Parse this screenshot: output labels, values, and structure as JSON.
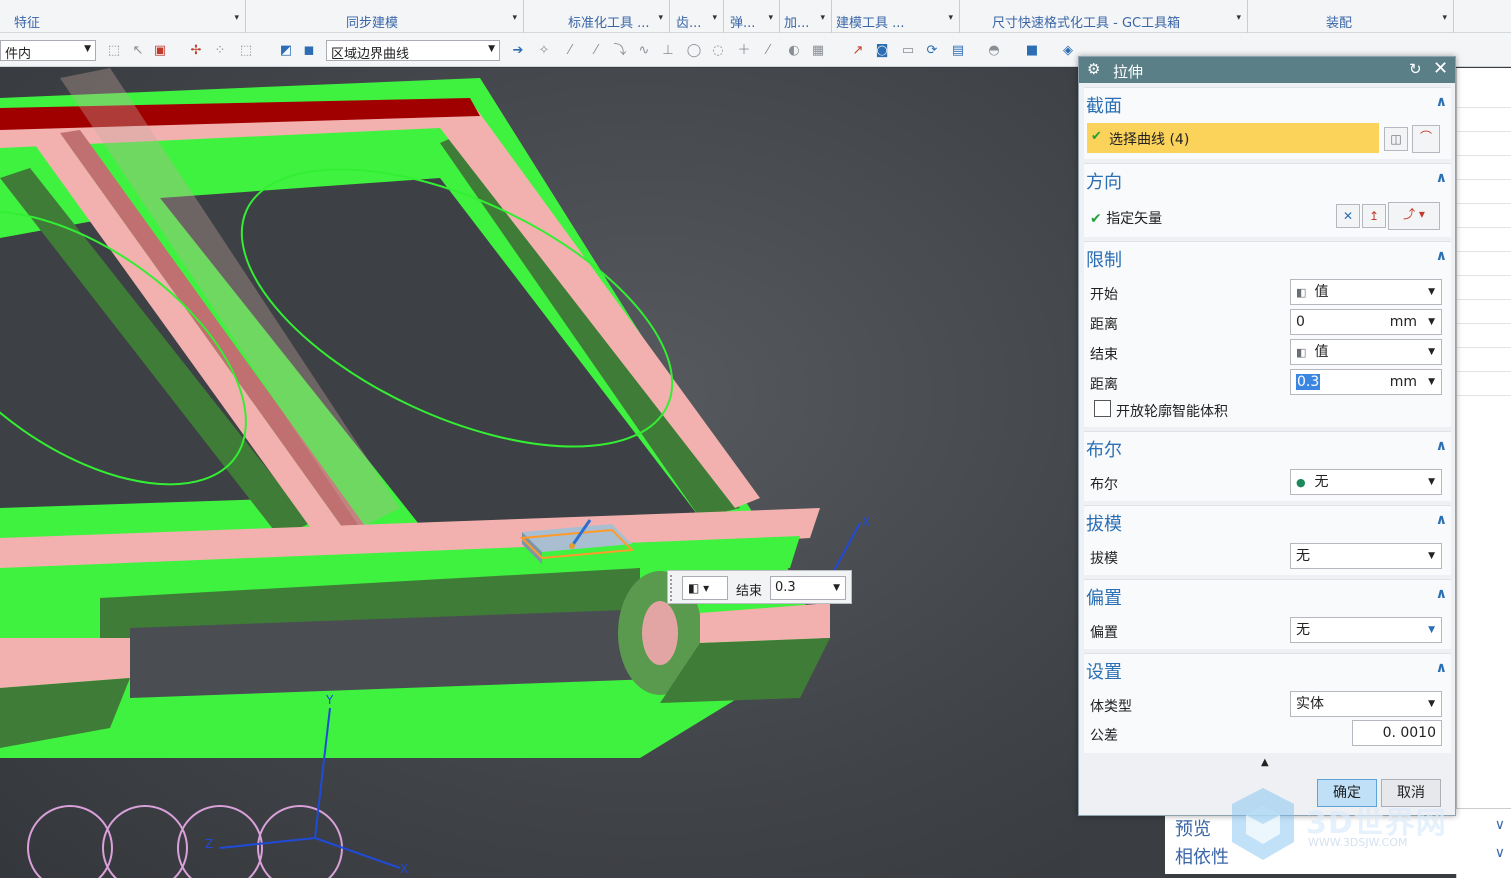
{
  "ribbon": {
    "groups": [
      "特征",
      "同步建模",
      "标准化工具 ...",
      "齿...",
      "弹...",
      "加...",
      "建模工具 ...",
      "尺寸快速格式化工具 - GC工具箱",
      "装配"
    ]
  },
  "toolbar": {
    "filter_combo": "件内",
    "curve_rule_combo": "区域边界曲线"
  },
  "inline_widget": {
    "label": "结束",
    "value": "0.3"
  },
  "dialog": {
    "title": "拉伸",
    "sections": {
      "section": {
        "header": "截面",
        "select_curve": "选择曲线 (4)"
      },
      "direction": {
        "header": "方向",
        "specify_vector": "指定矢量"
      },
      "limits": {
        "header": "限制",
        "start_label": "开始",
        "start_value": "值",
        "start_distance_label": "距离",
        "start_distance": "0",
        "end_label": "结束",
        "end_value": "值",
        "end_distance_label": "距离",
        "end_distance": "0.3",
        "unit": "mm",
        "open_profile_label": "开放轮廓智能体积"
      },
      "boolean": {
        "header": "布尔",
        "label": "布尔",
        "value": "无"
      },
      "draft": {
        "header": "拔模",
        "label": "拔模",
        "value": "无"
      },
      "offset": {
        "header": "偏置",
        "label": "偏置",
        "value": "无"
      },
      "settings": {
        "header": "设置",
        "body_type_label": "体类型",
        "body_type_value": "实体",
        "tolerance_label": "公差",
        "tolerance_value": "0. 0010"
      }
    },
    "ok_label": "确定",
    "cancel_label": "取消"
  },
  "nav_lower": {
    "preview": "预览",
    "dependencies": "相依性"
  },
  "watermark": {
    "text": "3D世界网",
    "url": "WWW.3DSJW.COM"
  },
  "colors": {
    "dialog_title": "#5b7f87",
    "section_header": "#2b6fb4",
    "selection_highlight": "#fbd35a",
    "model_green": "#3ff23f",
    "model_pink": "#f2b1ae",
    "model_red": "#a10000"
  }
}
